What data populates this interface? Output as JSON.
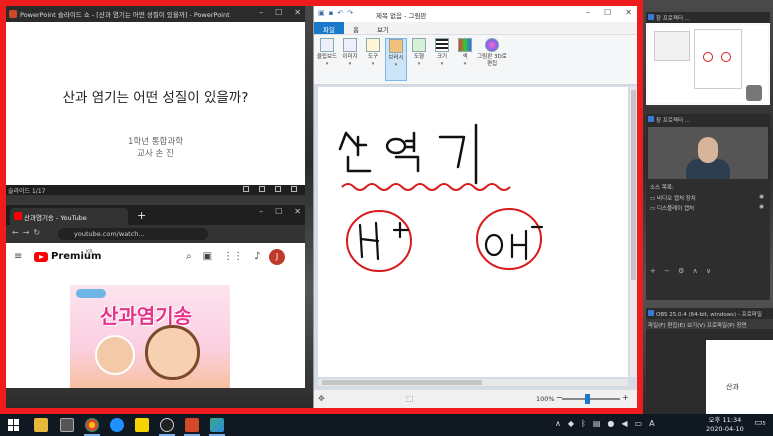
{
  "powerpoint": {
    "window_title": "PowerPoint 슬라이드 쇼 - [산과 염기는 어떤 성질이 있을까] - PowerPoint",
    "slide_title": "산과 염기는 어떤 성질이 있을까?",
    "slide_subtitle_1": "1학년 통합과학",
    "slide_subtitle_2": "교사 손 진",
    "status": "슬라이드 1/17"
  },
  "youtube": {
    "tab_title": "산과염기송 - YouTube",
    "new_tab": "+",
    "url": "youtube.com/watch...",
    "brand": "Premium",
    "region": "KR",
    "avatar_letter": "J",
    "thumbnail_text": "산과염기송"
  },
  "paint": {
    "window_title": "제목 없음 - 그림판",
    "tabs": [
      "파일",
      "홈",
      "보기"
    ],
    "ribbon": [
      {
        "label": "클립보드",
        "icon": "clipboard-icon"
      },
      {
        "label": "이미지",
        "icon": "image-icon"
      },
      {
        "label": "도구",
        "icon": "tools-icon"
      },
      {
        "label": "브러시",
        "icon": "brush-icon"
      },
      {
        "label": "도형",
        "icon": "shapes-icon"
      },
      {
        "label": "크기",
        "icon": "size-icon"
      },
      {
        "label": "색",
        "icon": "color-icon"
      },
      {
        "label": "그림판 3D로 편집",
        "icon": "paint3d-icon"
      }
    ],
    "canvas_words": {
      "title": "산 염기",
      "acid": "H",
      "acid_sup": "+",
      "base": "OH",
      "base_sup": "−"
    },
    "zoom": "100%",
    "zoom_minus": "−",
    "zoom_plus": "+"
  },
  "right_windows": {
    "window1_title": "창 프로젝터 ...",
    "window2_title": "창 프로젝터 ...",
    "sources_label": "소스 목록:",
    "source_1": "비디오 캡처 장치",
    "source_2": "디스플레이 캡처",
    "obs_title": "OBS 25.0.4 (64-bit, windows) - 프로파일",
    "obs_menu": "파일(F)  편집(E)  보기(V)  프로파일(P)  장면",
    "obs_preview_text": "산과"
  },
  "taskbar": {
    "time": "오후 11:34",
    "date": "2020-04-10",
    "ime": "A",
    "notifications": "5"
  },
  "colors": {
    "frame": "#ee1c1c",
    "paint_accent": "#1979ca",
    "ink": "#111111",
    "wave": "#d81b1b"
  }
}
